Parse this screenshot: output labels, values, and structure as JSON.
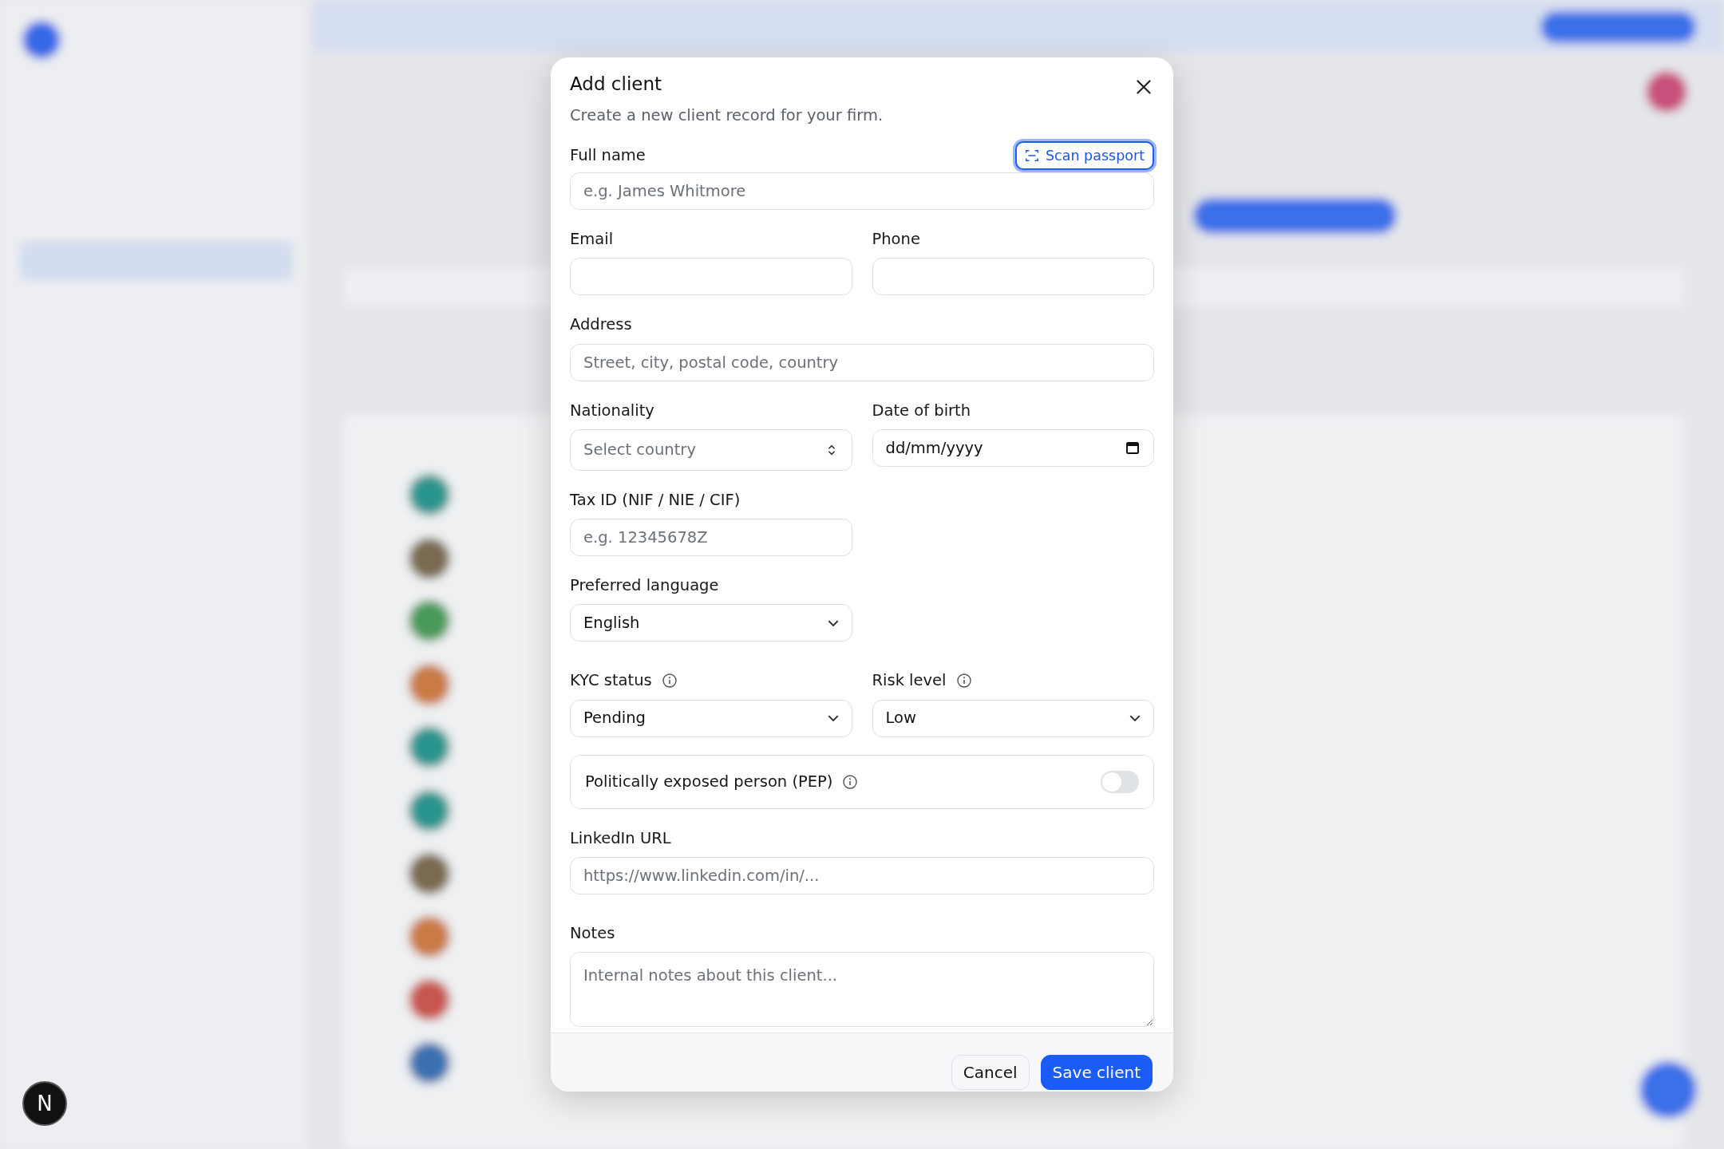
{
  "dialog": {
    "title": "Add client",
    "subtitle": "Create a new client record for your firm.",
    "scan_button": "Scan passport",
    "rows": [
      [
        {
          "kind": "text",
          "label": "Full name",
          "placeholder": "e.g. James Whitmore",
          "scan": true
        }
      ],
      [
        {
          "kind": "text",
          "label": "Email"
        },
        {
          "kind": "text",
          "label": "Phone"
        }
      ],
      [
        {
          "kind": "text",
          "label": "Address",
          "placeholder": "Street, city, postal code, country"
        }
      ],
      [
        {
          "kind": "combo",
          "label": "Nationality",
          "placeholder": "Select country"
        },
        {
          "kind": "date",
          "label": "Date of birth",
          "value": "dd/mm/yyyy"
        }
      ],
      [
        {
          "kind": "text",
          "label": "Tax ID (NIF / NIE / CIF)",
          "placeholder": "e.g. 12345678Z",
          "half": true
        }
      ],
      [
        {
          "kind": "select",
          "label": "Preferred language",
          "value": "English",
          "half": true
        }
      ],
      [
        {
          "kind": "select",
          "label": "KYC status",
          "value": "Pending",
          "info": true
        },
        {
          "kind": "select",
          "label": "Risk level",
          "value": "Low",
          "info": true
        }
      ],
      [
        {
          "kind": "toggle",
          "label": "Politically exposed person (PEP)",
          "info": true,
          "on": false
        }
      ],
      [
        {
          "kind": "text",
          "label": "LinkedIn URL",
          "placeholder": "https://www.linkedin.com/in/..."
        }
      ],
      [
        {
          "kind": "textarea",
          "label": "Notes",
          "placeholder": "Internal notes about this client..."
        }
      ]
    ],
    "buttons": [
      {
        "label": "Cancel",
        "kind": "secondary"
      },
      {
        "label": "Save client",
        "kind": "primary"
      }
    ]
  },
  "dev_badge": "N"
}
